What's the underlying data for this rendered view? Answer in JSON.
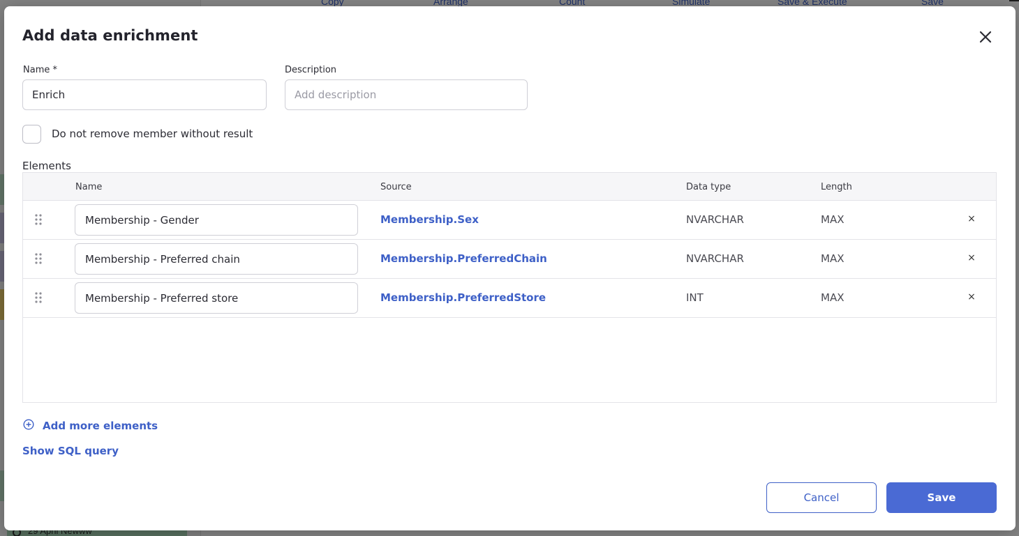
{
  "background": {
    "toolbar": [
      "Copy",
      "Arrange",
      "Count",
      "Simulate",
      "Save & Execute",
      "Save"
    ],
    "sidebar_item": "29 April Newww"
  },
  "dialog": {
    "title": "Add data enrichment",
    "name_label": "Name *",
    "name_value": "Enrich",
    "description_label": "Description",
    "description_placeholder": "Add description",
    "checkbox_label": "Do not remove member without result",
    "checkbox_checked": false,
    "elements_label": "Elements"
  },
  "table": {
    "columns": [
      "Name",
      "Source",
      "Data type",
      "Length"
    ],
    "rows": [
      {
        "name": "Membership - Gender",
        "source": "Membership.Sex",
        "data_type": "NVARCHAR",
        "length": "MAX"
      },
      {
        "name": "Membership - Preferred chain",
        "source": "Membership.PreferredChain",
        "data_type": "NVARCHAR",
        "length": "MAX"
      },
      {
        "name": "Membership - Preferred store",
        "source": "Membership.PreferredStore",
        "data_type": "INT",
        "length": "MAX"
      }
    ],
    "remove_glyph": "×"
  },
  "actions": {
    "add_more": "Add more elements",
    "show_sql": "Show SQL query",
    "cancel": "Cancel",
    "save": "Save"
  },
  "colors": {
    "accent": "#3e60c7",
    "primary_button": "#4a6ad4",
    "overlay": "rgba(0,0,0,0.48)"
  },
  "icons": {
    "close": "close-icon",
    "drag": "drag-handle-icon",
    "add": "plus-circle-icon"
  }
}
